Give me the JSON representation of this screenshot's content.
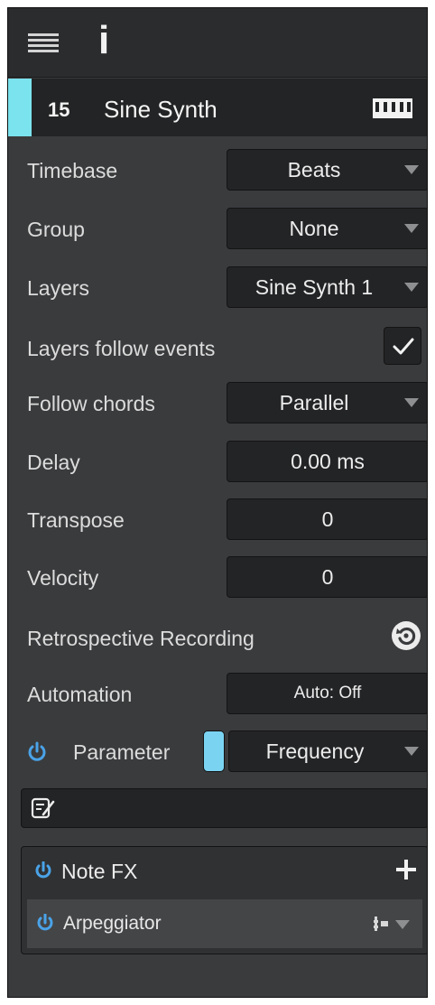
{
  "header": {
    "menu_icon": "hamburger-icon",
    "info_label": "i"
  },
  "track": {
    "number": "15",
    "name": "Sine Synth",
    "color": "#7be3ee",
    "instrument_icon": "keyboard-icon"
  },
  "fields": {
    "timebase": {
      "label": "Timebase",
      "value": "Beats"
    },
    "group": {
      "label": "Group",
      "value": "None"
    },
    "layers": {
      "label": "Layers",
      "value": "Sine Synth 1"
    },
    "layers_follow": {
      "label": "Layers follow events",
      "checked": true
    },
    "follow_chords": {
      "label": "Follow chords",
      "value": "Parallel"
    },
    "delay": {
      "label": "Delay",
      "value": "0.00 ms"
    },
    "transpose": {
      "label": "Transpose",
      "value": "0"
    },
    "velocity": {
      "label": "Velocity",
      "value": "0"
    },
    "retro": {
      "label": "Retrospective Recording",
      "icon": "retrospective-recording-icon"
    },
    "automation": {
      "label": "Automation",
      "value": "Auto: Off"
    },
    "parameter": {
      "label": "Parameter",
      "value": "Frequency",
      "color": "#7bd3f2"
    }
  },
  "notes": {
    "icon": "notes-edit-icon"
  },
  "note_fx": {
    "title": "Note FX",
    "items": [
      {
        "label": "Arpeggiator"
      }
    ]
  },
  "colors": {
    "accent_power": "#4aa3e8",
    "panel_bg": "#3a3b3d",
    "field_bg": "#232426"
  }
}
